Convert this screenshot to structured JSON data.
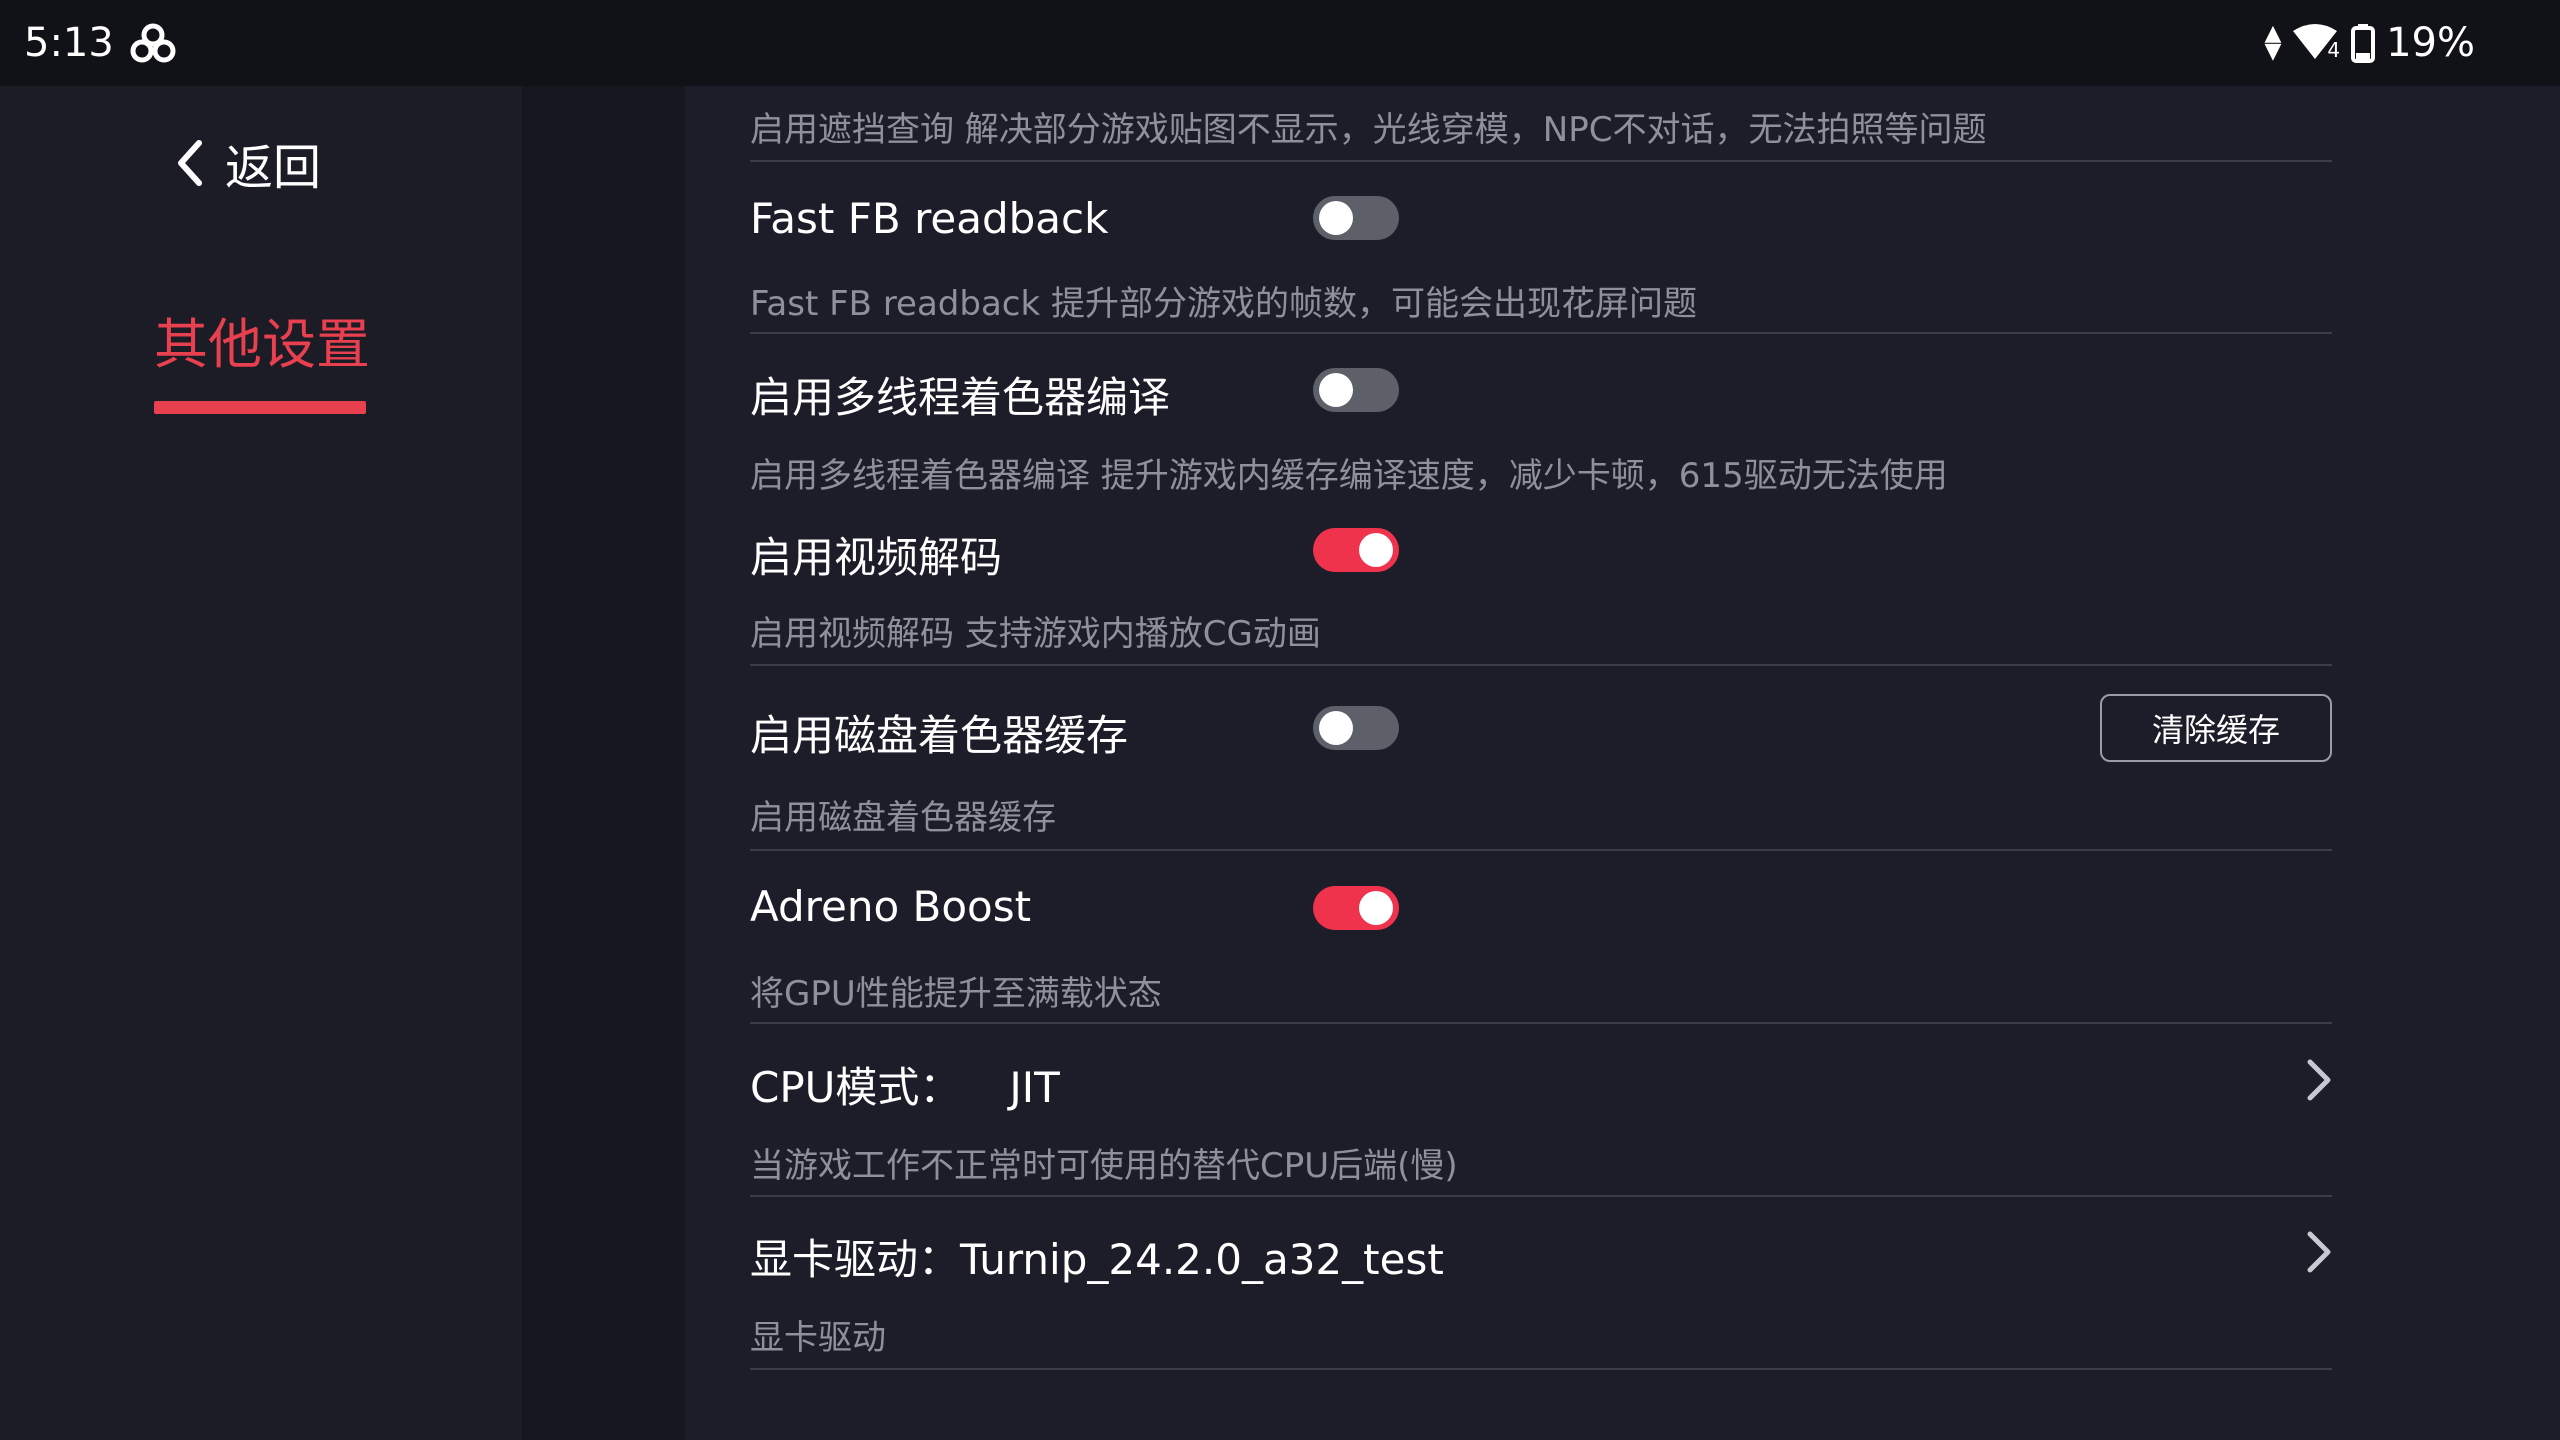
{
  "status_bar": {
    "time": "5:13",
    "network_badge": "4",
    "battery": "19%"
  },
  "nav": {
    "back_label": "返回",
    "category": "其他设置"
  },
  "settings": {
    "partial_desc": "启用遮挡查询 解决部分游戏贴图不显示，光线穿模，NPC不对话，无法拍照等问题",
    "fast_fb": {
      "title": "Fast FB readback",
      "desc": "Fast FB readback 提升部分游戏的帧数，可能会出现花屏问题",
      "enabled": false
    },
    "multithread_shader": {
      "title": "启用多线程着色器编译",
      "desc": "启用多线程着色器编译 提升游戏内缓存编译速度，减少卡顿，615驱动无法使用",
      "enabled": false
    },
    "video_decode": {
      "title": "启用视频解码",
      "desc": "启用视频解码 支持游戏内播放CG动画",
      "enabled": true
    },
    "disk_shader_cache": {
      "title": "启用磁盘着色器缓存",
      "desc": "启用磁盘着色器缓存",
      "enabled": false,
      "clear_button": "清除缓存"
    },
    "adreno_boost": {
      "title": "Adreno Boost",
      "desc": "将GPU性能提升至满载状态",
      "enabled": true
    },
    "cpu_mode": {
      "label": "CPU模式：",
      "value": "JIT",
      "desc": "当游戏工作不正常时可使用的替代CPU后端(慢)"
    },
    "gpu_driver": {
      "label": "显卡驱动：Turnip_24.2.0_a32_test",
      "desc": "显卡驱动"
    }
  },
  "colors": {
    "accent": "#f0334d",
    "background": "#1c1d28",
    "nav_background": "#1b1c26",
    "status_bar": "#111218",
    "description_text": "#8e909c"
  }
}
